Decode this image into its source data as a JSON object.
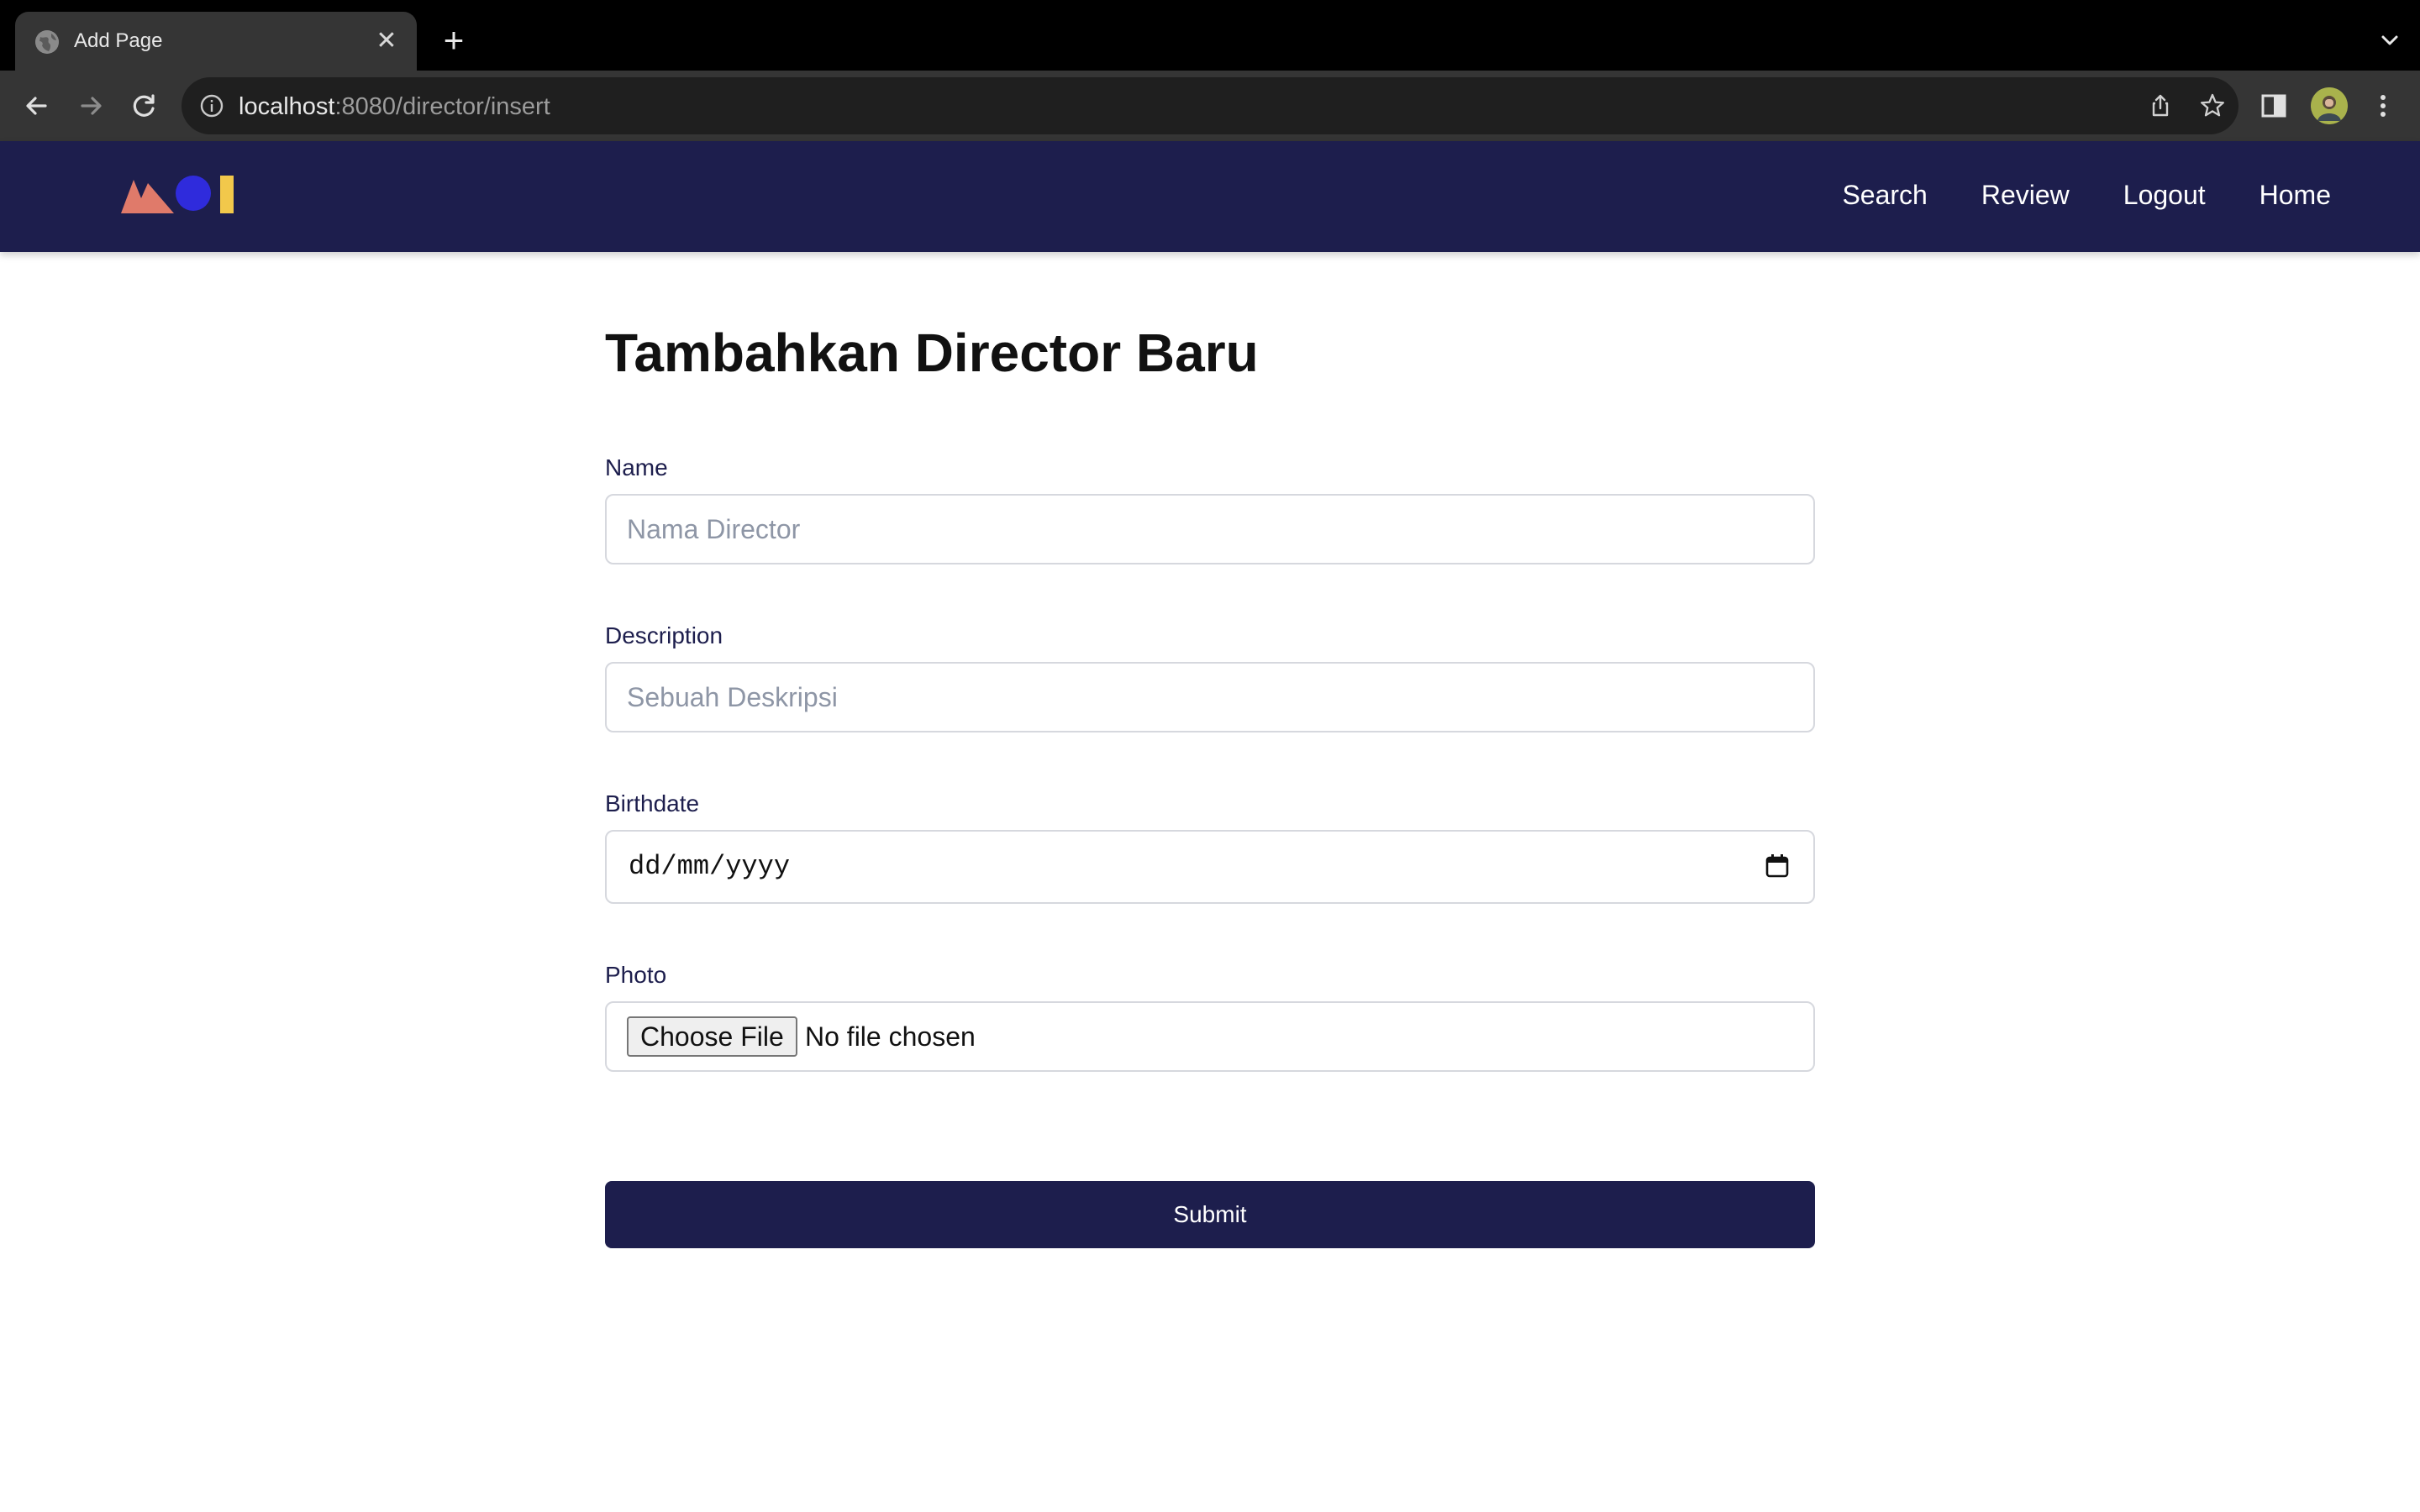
{
  "browser": {
    "tab_title": "Add Page",
    "url_host": "localhost",
    "url_path": ":8080/director/insert"
  },
  "navbar": {
    "links": [
      "Search",
      "Review",
      "Logout",
      "Home"
    ],
    "logo_colors": {
      "triangle": "#e07a6a",
      "circle": "#2f2bdc",
      "bar": "#f2c84b"
    }
  },
  "form": {
    "title": "Tambahkan Director Baru",
    "name_label": "Name",
    "name_placeholder": "Nama Director",
    "description_label": "Description",
    "description_placeholder": "Sebuah Deskripsi",
    "birthdate_label": "Birthdate",
    "birthdate_placeholder": "dd/mm/yyyy",
    "photo_label": "Photo",
    "choose_file_label": "Choose File",
    "no_file_text": "No file chosen",
    "submit_label": "Submit"
  },
  "colors": {
    "navbar": "#1d1e4d",
    "submit": "#1d1e4d"
  }
}
